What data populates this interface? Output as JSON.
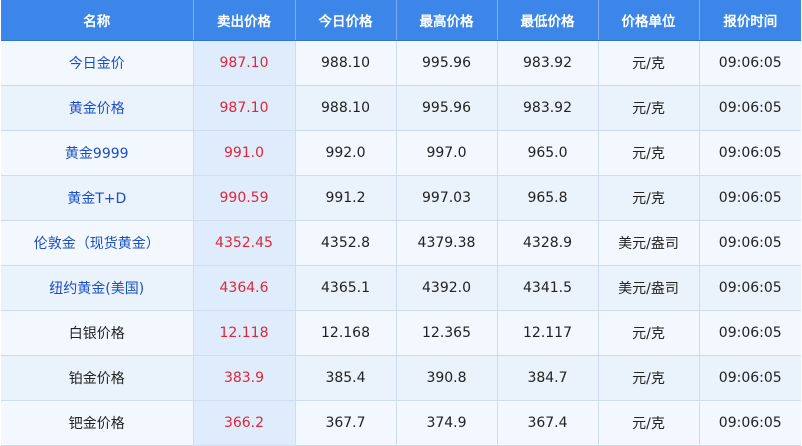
{
  "table": {
    "headers": [
      "名称",
      "卖出价格",
      "今日价格",
      "最高价格",
      "最低价格",
      "价格单位",
      "报价时间"
    ],
    "rows": [
      {
        "name": "今日金价",
        "linked": true,
        "sell": "987.10",
        "today": "988.10",
        "high": "995.96",
        "low": "983.92",
        "unit": "元/克",
        "time": "09:06:05"
      },
      {
        "name": "黄金价格",
        "linked": true,
        "sell": "987.10",
        "today": "988.10",
        "high": "995.96",
        "low": "983.92",
        "unit": "元/克",
        "time": "09:06:05"
      },
      {
        "name": "黄金9999",
        "linked": true,
        "sell": "991.0",
        "today": "992.0",
        "high": "997.0",
        "low": "965.0",
        "unit": "元/克",
        "time": "09:06:05"
      },
      {
        "name": "黄金T+D",
        "linked": true,
        "sell": "990.59",
        "today": "991.2",
        "high": "997.03",
        "low": "965.8",
        "unit": "元/克",
        "time": "09:06:05"
      },
      {
        "name": "伦敦金（现货黄金）",
        "linked": true,
        "sell": "4352.45",
        "today": "4352.8",
        "high": "4379.38",
        "low": "4328.9",
        "unit": "美元/盎司",
        "time": "09:06:05"
      },
      {
        "name": "纽约黄金(美国)",
        "linked": true,
        "sell": "4364.6",
        "today": "4365.1",
        "high": "4392.0",
        "low": "4341.5",
        "unit": "美元/盎司",
        "time": "09:06:05"
      },
      {
        "name": "白银价格",
        "linked": false,
        "sell": "12.118",
        "today": "12.168",
        "high": "12.365",
        "low": "12.117",
        "unit": "元/克",
        "time": "09:06:05"
      },
      {
        "name": "铂金价格",
        "linked": false,
        "sell": "383.9",
        "today": "385.4",
        "high": "390.8",
        "low": "384.7",
        "unit": "元/克",
        "time": "09:06:05"
      },
      {
        "name": "钯金价格",
        "linked": false,
        "sell": "366.2",
        "today": "367.7",
        "high": "374.9",
        "low": "367.4",
        "unit": "元/克",
        "time": "09:06:05"
      }
    ]
  },
  "colors": {
    "header_bg": "#3b86e8",
    "link_text": "#1a4fc4",
    "sell_price": "#e0263a",
    "row_odd": "#f3f8fe",
    "row_even": "#eaf2fc"
  }
}
